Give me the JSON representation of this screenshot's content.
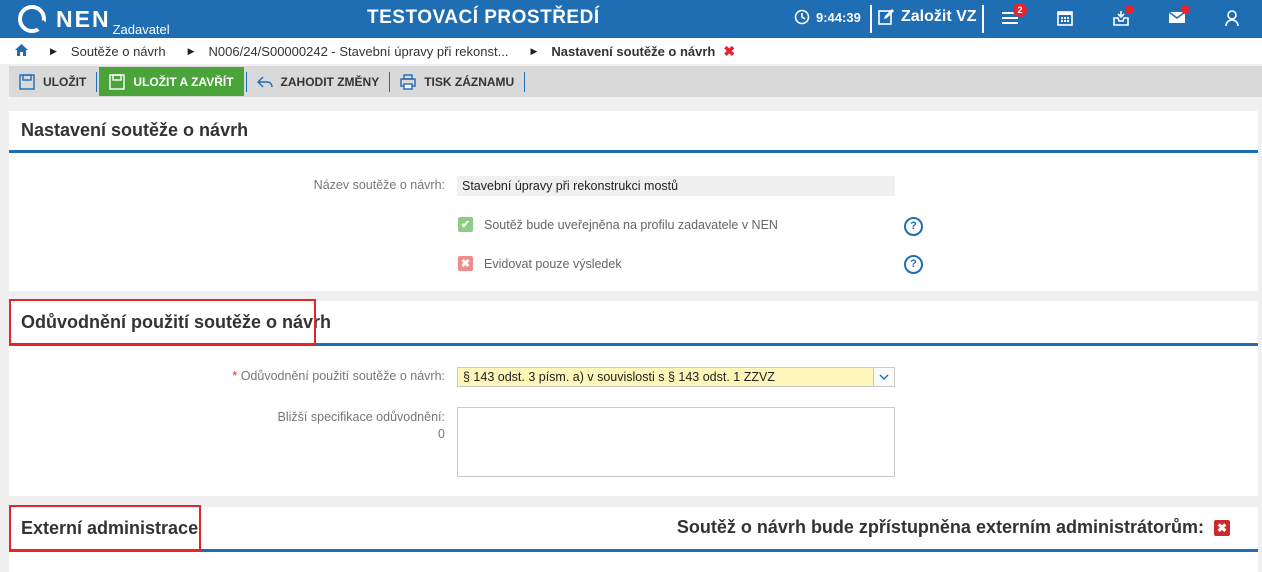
{
  "app": {
    "logo_name": "NEN",
    "logo_sub": "Zadavatel",
    "env_title": "TESTOVACÍ PROSTŘEDÍ",
    "clock": "9:44:39",
    "create_label": "Založit VZ",
    "menu_badge": "2"
  },
  "breadcrumb": {
    "items": [
      "Soutěže o návrh",
      "N006/24/S00000242 - Stavební úpravy při rekonst..."
    ],
    "active": "Nastavení soutěže o návrh",
    "close_glyph": "✖"
  },
  "toolbar": {
    "save": "ULOŽIT",
    "save_close": "ULOŽIT A ZAVŘÍT",
    "discard": "ZAHODIT ZMĚNY",
    "print": "TISK ZÁZNAMU"
  },
  "section1": {
    "title": "Nastavení soutěže o návrh",
    "name_label": "Název soutěže o návrh:",
    "name_value": "Stavební úpravy při rekonstrukci mostů",
    "publish_label": "Soutěž bude uveřejněna na profilu zadavatele v NEN",
    "publish_checked": true,
    "result_only_label": "Evidovat pouze výsledek",
    "result_only_checked": false,
    "help_glyph": "?"
  },
  "section2": {
    "title": "Odůvodnění použití soutěže o návrh",
    "required_mark": "*",
    "reason_label": "Odůvodnění použití soutěže o návrh:",
    "reason_value": "§ 143 odst. 3 písm. a) v souvislosti s § 143 odst. 1 ZZVZ",
    "spec_label": "Bližší specifikace odůvodnění:",
    "spec_count": "0",
    "spec_value": ""
  },
  "section3": {
    "title": "Externí administrace",
    "access_label": "Soutěž o návrh bude zpřístupněna externím administrátorům:",
    "access_value": "✖"
  },
  "colors": {
    "brand": "#1f6db3",
    "green": "#4aa43a",
    "red": "#e4262c",
    "field_highlight": "#fff6b9"
  }
}
